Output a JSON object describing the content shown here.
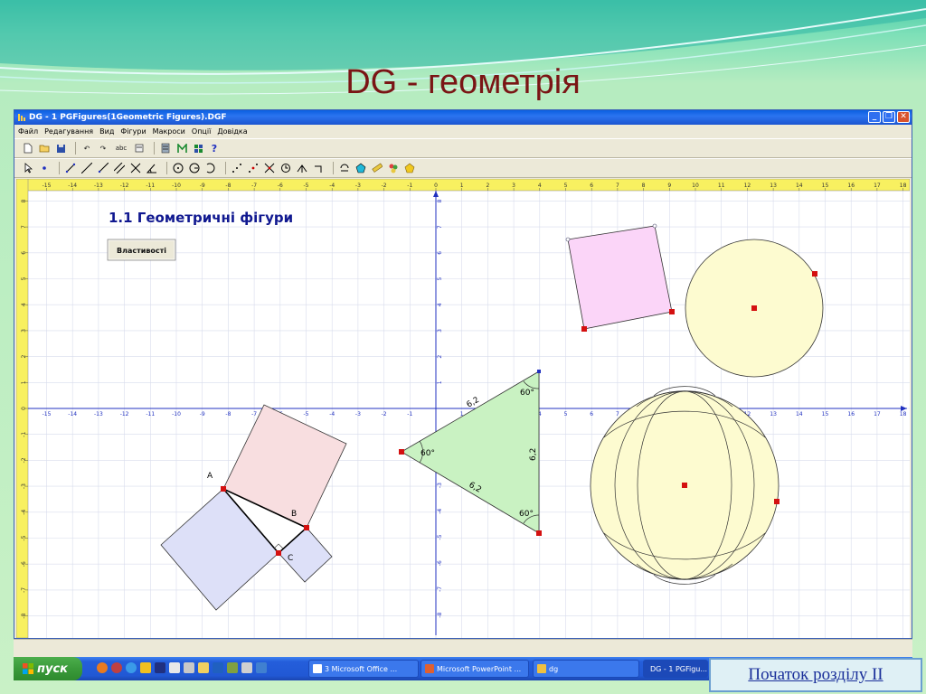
{
  "slide": {
    "title": "DG - геометрія",
    "nav_link": "Початок розділу II"
  },
  "window": {
    "title": "DG - 1 PGFigures(1Geometric Figures).DGF",
    "minimize": "_",
    "maximize": "❐",
    "close": "✕"
  },
  "menu": [
    "Файл",
    "Редагування",
    "Вид",
    "Фігури",
    "Макроси",
    "Опції",
    "Довідка"
  ],
  "toolbar1": {
    "icons": [
      "new-icon",
      "open-icon",
      "save-icon",
      "undo-icon",
      "redo-icon",
      "text-icon",
      "calc-icon",
      "measure-icon",
      "macro-icon",
      "grid-icon",
      "help-icon"
    ],
    "text_tool": "abc",
    "help": "?"
  },
  "toolbar2": {
    "icons": [
      "select-icon",
      "point-icon",
      "segment-icon",
      "line-icon",
      "ray-icon",
      "parallel-icon",
      "perpendicular-icon",
      "angle-icon",
      "circle-icon",
      "circle2-icon",
      "arc-icon",
      "locus-icon",
      "midpoint-icon",
      "intersect-icon",
      "compass-icon",
      "reflect-icon",
      "rotate-icon",
      "trace-icon",
      "polygon-icon",
      "ruler-icon",
      "color-icon",
      "fill-icon"
    ]
  },
  "canvas": {
    "heading": "1.1 Геометричні фігури",
    "properties_button": "Властивості",
    "x_ticks": [
      "-15",
      "-14",
      "-13",
      "-12",
      "-11",
      "-10",
      "-9",
      "-8",
      "-7",
      "-6",
      "-5",
      "-4",
      "-3",
      "-2",
      "-1",
      "0",
      "1",
      "2",
      "3",
      "4",
      "5",
      "6",
      "7",
      "8",
      "9",
      "10",
      "11",
      "12",
      "13",
      "14",
      "15",
      "16",
      "17",
      "18"
    ],
    "y_ticks": [
      "8",
      "7",
      "6",
      "5",
      "4",
      "3",
      "2",
      "1",
      "0",
      "-1",
      "-2",
      "-3",
      "-4",
      "-5",
      "-6",
      "-7",
      "-8"
    ],
    "labels": {
      "point_a": "A",
      "point_b": "B",
      "point_c": "C",
      "side1": "6,2",
      "side2": "6,2",
      "side3": "6,2",
      "angle1": "60°",
      "angle2": "60°",
      "angle3": "60°"
    }
  },
  "taskbar": {
    "start": "пуск",
    "tasks": [
      "3 Microsoft Office ...",
      "Microsoft PowerPoint ...",
      "dg",
      "DG - 1 PGFigu..."
    ]
  },
  "colors": {
    "title": "#7a1515",
    "square_fill": "#fbd5f8",
    "circle_fill": "#fdfbd0",
    "triangle_fill": "#c9f2c2",
    "pyth_red": "#f8dee0",
    "pyth_blue": "#dde0f8",
    "grid": "#d8dcec",
    "point": "#d41010"
  }
}
